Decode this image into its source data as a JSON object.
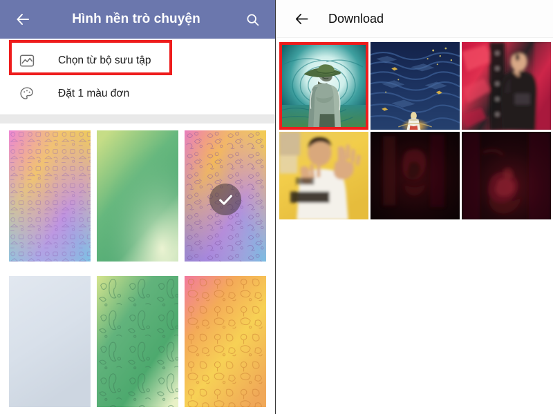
{
  "left_panel": {
    "appbar": {
      "back_icon": "arrow-left-icon",
      "title": "Hình nền trò chuyện",
      "search_icon": "search-icon",
      "background_color": "#6b77ad",
      "title_color": "#ffffff"
    },
    "options": [
      {
        "icon": "image-picture-icon",
        "label": "Chọn từ bộ sưu tập",
        "highlighted": true,
        "highlight_color": "#ee1c1c"
      },
      {
        "icon": "color-palette-icon",
        "label": "Đặt 1 màu đơn",
        "highlighted": false
      }
    ],
    "wallpapers": [
      {
        "id": "wp-1",
        "name": "pink-yellow-cyan-doodle",
        "selected": false,
        "pattern": "doodle-objects",
        "colors": [
          "#ef7fd4",
          "#f5d24a",
          "#8f7fe8",
          "#57cfe8"
        ]
      },
      {
        "id": "wp-2",
        "name": "green-gradient-plain",
        "selected": false,
        "pattern": "none",
        "colors": [
          "#bcd97e",
          "#5fb87d",
          "#e6f0c6"
        ]
      },
      {
        "id": "wp-3",
        "name": "rainbow-animal-doodle",
        "selected": true,
        "pattern": "doodle-animals",
        "colors": [
          "#f078b4",
          "#f5c33c",
          "#9b7fe0",
          "#5fc8e8"
        ]
      },
      {
        "id": "wp-4",
        "name": "light-gray-blue-plain",
        "selected": false,
        "pattern": "none",
        "colors": [
          "#dde4ec",
          "#cfd8e3"
        ]
      },
      {
        "id": "wp-5",
        "name": "green-kangaroo-doodle",
        "selected": false,
        "pattern": "doodle-animals",
        "colors": [
          "#cfe08a",
          "#4aa96b",
          "#e9f2c8"
        ]
      },
      {
        "id": "wp-6",
        "name": "pink-orange-food-doodle",
        "selected": false,
        "pattern": "doodle-food",
        "colors": [
          "#f2799e",
          "#f5c344",
          "#f0a858"
        ]
      }
    ],
    "selected_check_icon": "check-icon"
  },
  "right_panel": {
    "appbar": {
      "back_icon": "arrow-left-icon",
      "title": "Download",
      "background_color": "#fdfdfd",
      "title_color": "#0c0c0c"
    },
    "images": [
      {
        "id": "img-1",
        "name": "man-in-wide-brim-hat-illustration",
        "selected": true,
        "selection_color": "#ee1c1c"
      },
      {
        "id": "img-2",
        "name": "blue-maze-lantern-illustration",
        "selected": false
      },
      {
        "id": "img-3",
        "name": "singer-on-red-stage-photo",
        "selected": false
      },
      {
        "id": "img-4",
        "name": "person-waving-hand-yellow-photo",
        "selected": false
      },
      {
        "id": "img-5",
        "name": "dark-red-silhouette-photo",
        "selected": false
      },
      {
        "id": "img-6",
        "name": "dark-red-dancer-photo",
        "selected": false
      }
    ]
  }
}
